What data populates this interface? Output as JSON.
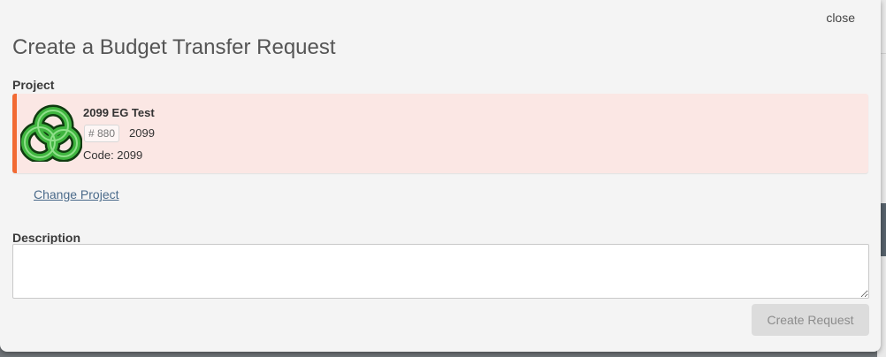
{
  "modal": {
    "close_label": "close",
    "title": "Create a Budget Transfer Request"
  },
  "project": {
    "section_label": "Project",
    "name": "2099 EG Test",
    "badge": "# 880",
    "number": "2099",
    "code": "Code: 2099",
    "change_label": "Change Project",
    "logo_icon": "project-logo-icon",
    "accent_color": "#f26a33",
    "card_color": "#fbe7e4"
  },
  "description": {
    "section_label": "Description",
    "value": "",
    "placeholder": ""
  },
  "actions": {
    "create_label": "Create Request",
    "create_disabled": true
  }
}
